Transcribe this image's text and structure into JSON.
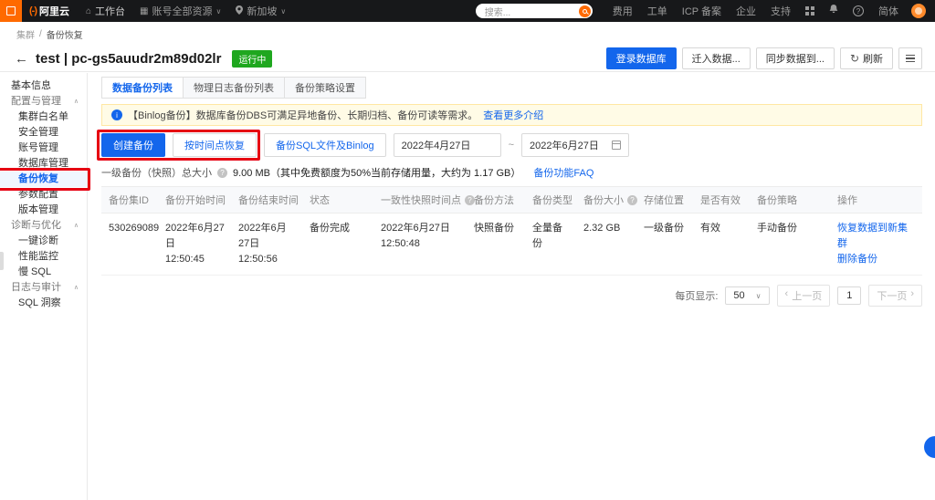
{
  "topbar": {
    "logo_mark": "(-)",
    "logo": "阿里云",
    "workbench": "工作台",
    "resource_scope": "账号全部资源",
    "region": "新加坡",
    "search_placeholder": "搜索...",
    "links": [
      "费用",
      "工单",
      "ICP 备案",
      "企业",
      "支持"
    ],
    "language": "简体"
  },
  "breadcrumb": {
    "root": "集群",
    "separator": "/",
    "current": "备份恢复"
  },
  "header": {
    "title": "test | pc-gs5auudr2m89d02lr",
    "status_badge": "运行中",
    "login_db": "登录数据库",
    "migrate_in": "迁入数据...",
    "sync_to": "同步数据到...",
    "refresh": "刷新"
  },
  "sidebar": {
    "items": [
      {
        "label": "基本信息"
      },
      {
        "label": "配置与管理"
      },
      {
        "label": "集群白名单"
      },
      {
        "label": "安全管理"
      },
      {
        "label": "账号管理"
      },
      {
        "label": "数据库管理"
      },
      {
        "label": "备份恢复"
      },
      {
        "label": "参数配置"
      },
      {
        "label": "版本管理"
      },
      {
        "label": "诊断与优化"
      },
      {
        "label": "一键诊断"
      },
      {
        "label": "性能监控"
      },
      {
        "label": "慢 SQL"
      },
      {
        "label": "日志与审计"
      },
      {
        "label": "SQL 洞察"
      }
    ]
  },
  "tabs": [
    {
      "label": "数据备份列表"
    },
    {
      "label": "物理日志备份列表"
    },
    {
      "label": "备份策略设置"
    }
  ],
  "banner": {
    "text": "【Binlog备份】数据库备份DBS可满足异地备份、长期归档、备份可读等需求。",
    "link": "查看更多介绍"
  },
  "toolbar": {
    "create_backup": "创建备份",
    "restore_point": "按时间点恢复",
    "backup_sql": "备份SQL文件及Binlog",
    "date_start": "2022年4月27日",
    "range_separator": "~",
    "date_end": "2022年6月27日"
  },
  "summary": {
    "label": "一级备份（快照）总大小",
    "value": "9.00 MB（其中免费额度为50%当前存储用量，大约为 1.17 GB）",
    "faq": "备份功能FAQ"
  },
  "table": {
    "headers": [
      "备份集ID",
      "备份开始时间",
      "备份结束时间",
      "状态",
      "一致性快照时间点",
      "备份方法",
      "备份类型",
      "备份大小",
      "存储位置",
      "是否有效",
      "备份策略",
      "操作"
    ],
    "row": {
      "id": "530269089",
      "start_date": "2022年6月27日",
      "start_time": "12:50:45",
      "end_date": "2022年6月27日",
      "end_time": "12:50:56",
      "status": "备份完成",
      "snapshot_date": "2022年6月27日",
      "snapshot_time": "12:50:48",
      "method": "快照备份",
      "type": "全量备份",
      "size": "2.32 GB",
      "location": "一级备份",
      "valid": "有效",
      "policy": "手动备份",
      "action_restore": "恢复数据到新集群",
      "action_delete": "删除备份"
    }
  },
  "pagination": {
    "per_page_label": "每页显示:",
    "per_page": "50",
    "prev": "上一页",
    "page": "1",
    "next": "下一页"
  },
  "colors": {
    "accent": "#1366ec",
    "brand_orange": "#ff6a00",
    "status_green": "#1fa71f",
    "annotation_red": "#e60012"
  }
}
